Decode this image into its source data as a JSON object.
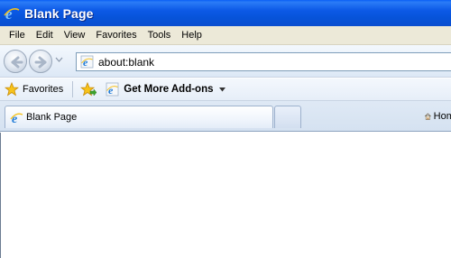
{
  "window": {
    "title": "Blank Page"
  },
  "menu": {
    "items": [
      {
        "label": "File"
      },
      {
        "label": "Edit"
      },
      {
        "label": "View"
      },
      {
        "label": "Favorites"
      },
      {
        "label": "Tools"
      },
      {
        "label": "Help"
      }
    ]
  },
  "navigation": {
    "address": "about:blank"
  },
  "favorites_bar": {
    "favorites_label": "Favorites",
    "addons_label": "Get More Add-ons"
  },
  "tabs": {
    "active_label": "Blank Page",
    "home_label": "Home"
  },
  "icons": {
    "browser": "ie-logo-icon",
    "back": "back-arrow-icon",
    "forward": "forward-arrow-icon",
    "favorites": "star-icon",
    "add_favorite": "add-favorite-icon",
    "home": "home-icon"
  },
  "colors": {
    "titlebar": "#0a5ef5",
    "menubar": "#ece9d8",
    "toolbar": "#e7eff9",
    "ie_logo": "#1e7ad6"
  }
}
